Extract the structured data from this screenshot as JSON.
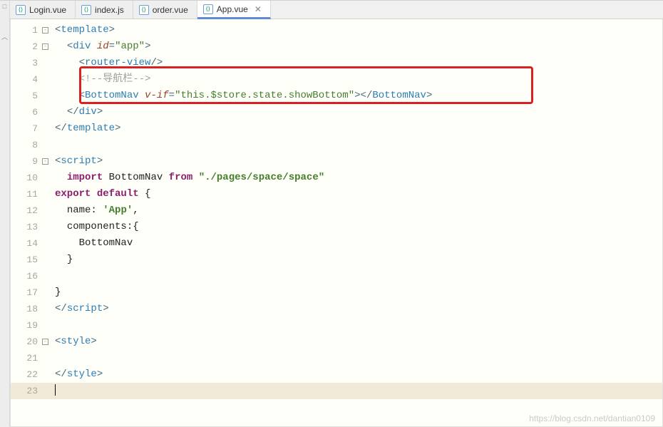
{
  "tabs": [
    {
      "label": "Login.vue"
    },
    {
      "label": "index.js"
    },
    {
      "label": "order.vue"
    },
    {
      "label": "App.vue",
      "active": true,
      "close": "✕"
    }
  ],
  "code": {
    "l1": {
      "t1": "<",
      "t2": "template",
      "t3": ">"
    },
    "l2": {
      "sp": "  ",
      "t1": "<",
      "t2": "div",
      "sp2": " ",
      "a1": "id",
      "t3": "=",
      "s1": "\"app\"",
      "t4": ">"
    },
    "l3": {
      "sp": "    ",
      "t1": "<",
      "t2": "router-view",
      "t3": "/>"
    },
    "l4": {
      "sp": "    ",
      "c": "<!--导航栏-->"
    },
    "l5": {
      "sp": "    ",
      "t1": "<",
      "t2": "BottomNav",
      "sp2": " ",
      "a1": "v-if",
      "t3": "=",
      "s1": "\"this.$store.state.showBottom\"",
      "t4": ">",
      "t5": "</",
      "t6": "BottomNav",
      "t7": ">"
    },
    "l6": {
      "sp": "  ",
      "t1": "</",
      "t2": "div",
      "t3": ">"
    },
    "l7": {
      "t1": "</",
      "t2": "template",
      "t3": ">"
    },
    "l9a": {
      "t1": "<",
      "t2": "script",
      "t3": ">"
    },
    "l10": {
      "sp": "  ",
      "k1": "import",
      "sp2": " ",
      "n1": "BottomNav",
      "sp3": " ",
      "k2": "from",
      "sp4": " ",
      "s1": "\"./pages/space/space\""
    },
    "l11": {
      "k1": "export",
      "sp": " ",
      "k2": "default",
      "sp2": " ",
      "n1": "{"
    },
    "l12": {
      "sp": "  ",
      "n1": "name:",
      "sp2": " ",
      "s1": "'App'",
      "n2": ","
    },
    "l13": {
      "sp": "  ",
      "n1": "components:{"
    },
    "l14": {
      "sp": "    ",
      "n1": "BottomNav"
    },
    "l15": {
      "sp": "  ",
      "n1": "}"
    },
    "l17": {
      "n1": "}"
    },
    "l18": {
      "t1": "</",
      "t2": "script",
      "t3": ">"
    },
    "l20": {
      "t1": "<",
      "t2": "style",
      "t3": ">"
    },
    "l22": {
      "t1": "</",
      "t2": "style",
      "t3": ">"
    }
  },
  "lineNumbers": [
    "1",
    "2",
    "3",
    "4",
    "5",
    "6",
    "7",
    "8",
    "9",
    "10",
    "11",
    "12",
    "13",
    "14",
    "15",
    "16",
    "17",
    "18",
    "19",
    "20",
    "21",
    "22",
    "23"
  ],
  "watermark": "https://blog.csdn.net/dantian0109"
}
